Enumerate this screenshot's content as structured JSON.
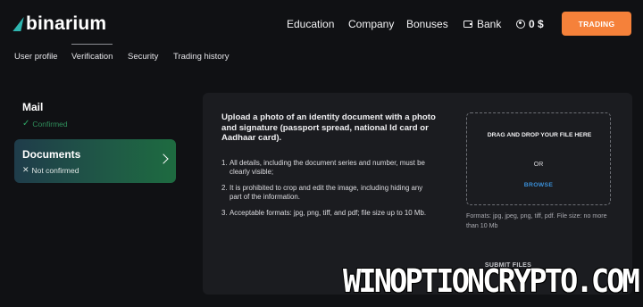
{
  "header": {
    "logo_text": "binarium",
    "nav": [
      "Education",
      "Company",
      "Bonuses"
    ],
    "bank_label": "Bank",
    "bank_icon": "wallet-icon",
    "balance": "0 $",
    "balance_icon": "user-icon",
    "trading_button": "TRADING"
  },
  "subnav": {
    "items": [
      "User profile",
      "Verification",
      "Security",
      "Trading history"
    ],
    "active": "Verification"
  },
  "steps": {
    "mail": {
      "title": "Mail",
      "status": "Confirmed",
      "status_icon": "check-icon"
    },
    "documents": {
      "title": "Documents",
      "status": "Not confirmed",
      "status_icon": "x-icon",
      "arrow_icon": "chevron-right-icon"
    }
  },
  "upload": {
    "title": "Upload a photo of an identity document with a photo and signature (passport spread, national Id card or Aadhaar card).",
    "rules": [
      "All details, including the document series and number, must be clearly visible;",
      "It is prohibited to crop and edit the image, including hiding any part of the information.",
      "Acceptable formats: jpg, png, tiff, and pdf; file size up to 10 Mb."
    ],
    "dropzone": {
      "title": "DRAG AND DROP YOUR FILE HERE",
      "or": "OR",
      "browse": "BROWSE"
    },
    "formats_note": "Formats: jpg, jpeg, png, tiff, pdf. File size: no more than 10 Mb",
    "submit": "SUBMIT FILES"
  },
  "watermark": "WINOPTIONCRYPTO.COM",
  "colors": {
    "background": "#101114",
    "panel": "#1b1c20",
    "accent_orange": "#f5813a",
    "logo_teal": "#2fb6b0",
    "confirmed_green": "#2f8e5b",
    "browse_blue": "#3a8fd8"
  }
}
